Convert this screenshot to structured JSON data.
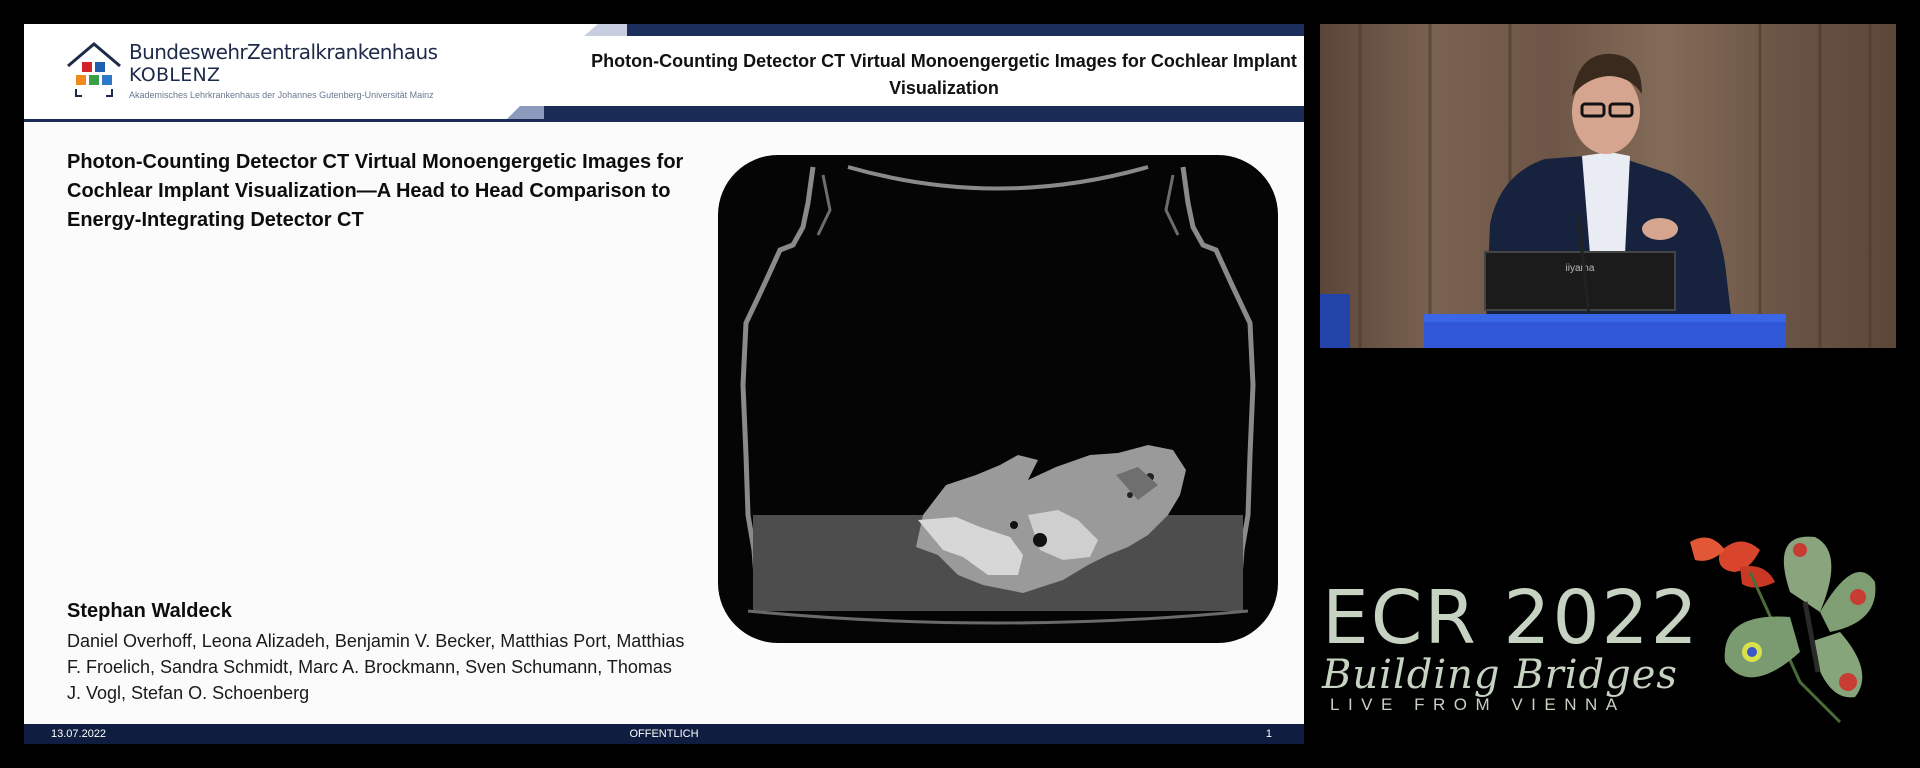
{
  "slide": {
    "institution_name": "BundeswehrZentralkrankenhaus",
    "institution_city": "KOBLENZ",
    "institution_affiliation": "Akademisches Lehrkrankenhaus der Johannes Gutenberg-Universität Mainz",
    "header_title": "Photon-Counting Detector CT Virtual Monoengergetic Images for Cochlear Implant Visualization",
    "paper_title": "Photon-Counting Detector CT Virtual Monoengergetic Images for Cochlear Implant Visualization—A Head to Head Comparison to Energy-Integrating Detector CT",
    "presenter": "Stephan Waldeck",
    "coauthors": "Daniel Overhoff, Leona Alizadeh, Benjamin V. Becker, Matthias Port, Matthias F. Froelich, Sandra Schmidt, Marc A. Brockmann, Sven Schumann, Thomas J. Vogl, Stefan O. Schoenberg",
    "footer_date": "13.07.2022",
    "footer_classification": "OFFENTLICH",
    "footer_page": "1"
  },
  "video": {
    "monitor_brand": "iiyama"
  },
  "event": {
    "title": "ECR 2022",
    "subtitle": "Building Bridges",
    "tagline": "LIVE FROM VIENNA"
  },
  "colors": {
    "navy": "#1a2c55",
    "footer": "#0f1e40",
    "ecr_text": "#c7d3c2",
    "logo_red": "#d3232a",
    "logo_blue": "#1f5fae",
    "logo_orange": "#f08a1c",
    "logo_green": "#3aa04a"
  },
  "icons": {
    "logo": "house-logo-icon",
    "butterfly": "butterfly-flower-icon"
  }
}
